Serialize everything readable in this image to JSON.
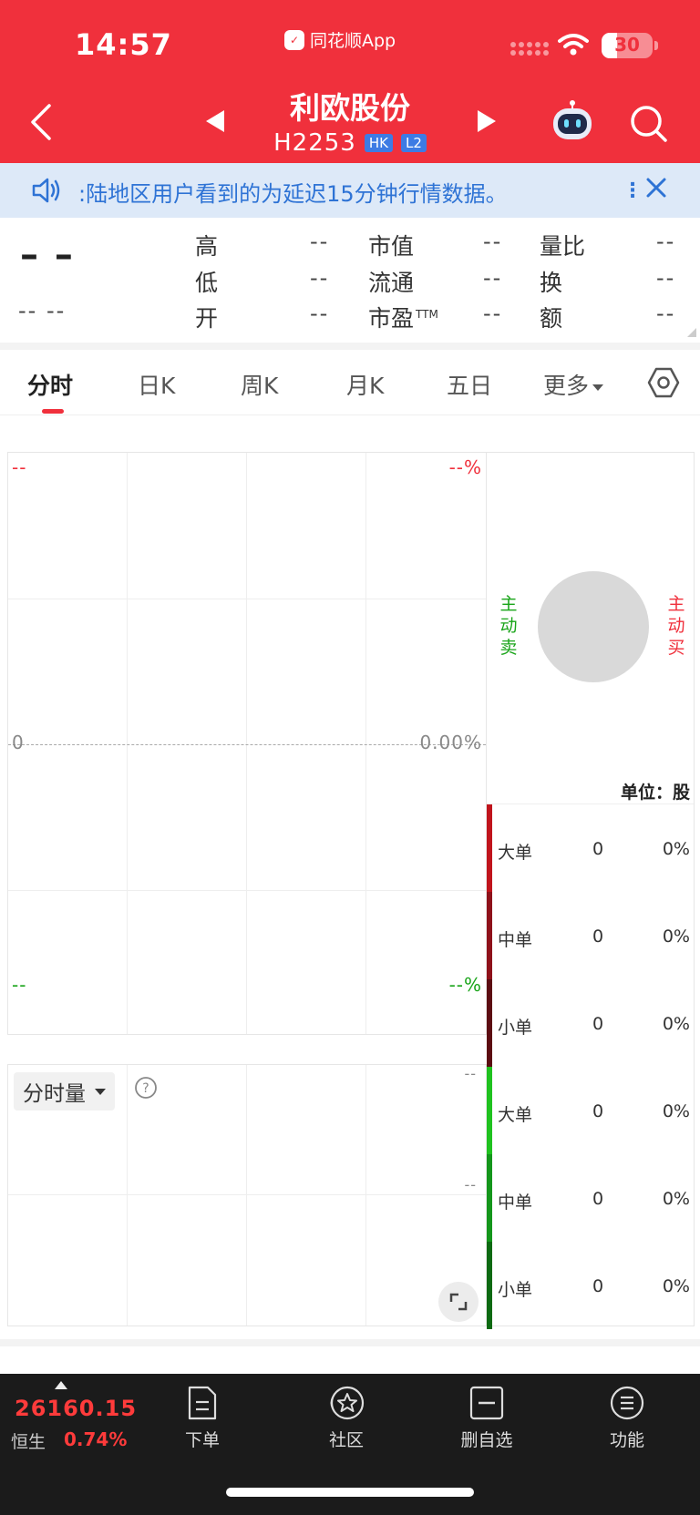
{
  "status_bar": {
    "time": "14:57",
    "app_badge": "同花顺App",
    "battery": "30"
  },
  "header": {
    "stock_name": "利欧股份",
    "stock_code": "H2253",
    "tags": [
      "HK",
      "L2"
    ]
  },
  "notice": {
    "text": ":陆地区用户看到的为延迟15分钟行情数据。"
  },
  "quote": {
    "price": "– –",
    "change": "-- --",
    "fields": [
      {
        "label": "高",
        "value": "--"
      },
      {
        "label": "低",
        "value": "--"
      },
      {
        "label": "开",
        "value": "--"
      },
      {
        "label": "市值",
        "value": "--"
      },
      {
        "label": "流通",
        "value": "--"
      },
      {
        "label": "市盈",
        "value": "--",
        "sup": "TTM"
      },
      {
        "label": "量比",
        "value": "--"
      },
      {
        "label": "换",
        "value": "--"
      },
      {
        "label": "额",
        "value": "--"
      }
    ]
  },
  "tabs": {
    "items": [
      "分时",
      "日K",
      "周K",
      "月K",
      "五日",
      "更多"
    ],
    "active_index": 0
  },
  "chart": {
    "top_left": "--",
    "top_right": "--%",
    "mid_left": "0",
    "mid_right": "0.00%",
    "bottom_left": "--",
    "bottom_right": "--%",
    "volume_button": "分时量",
    "vol_tick_1": "--",
    "vol_tick_2": "--",
    "colors": {
      "up": "#f0303c",
      "down": "#1aa51a"
    }
  },
  "side_panel": {
    "active_sell": "主动卖",
    "active_buy": "主动买",
    "unit": "单位：股",
    "rows": [
      {
        "name": "大单",
        "volume": "0",
        "pct": "0%",
        "color": "#c0141c"
      },
      {
        "name": "中单",
        "volume": "0",
        "pct": "0%",
        "color": "#8e111a"
      },
      {
        "name": "小单",
        "volume": "0",
        "pct": "0%",
        "color": "#5c0c12"
      },
      {
        "name": "大单",
        "volume": "0",
        "pct": "0%",
        "color": "#1fc21f"
      },
      {
        "name": "中单",
        "volume": "0",
        "pct": "0%",
        "color": "#14961b"
      },
      {
        "name": "小单",
        "volume": "0",
        "pct": "0%",
        "color": "#0c6a12"
      }
    ]
  },
  "bottom_bar": {
    "index_value": "26160.15",
    "index_name": "恒生",
    "index_pct": "0.74%",
    "nav": [
      "下单",
      "社区",
      "删自选",
      "功能"
    ]
  }
}
